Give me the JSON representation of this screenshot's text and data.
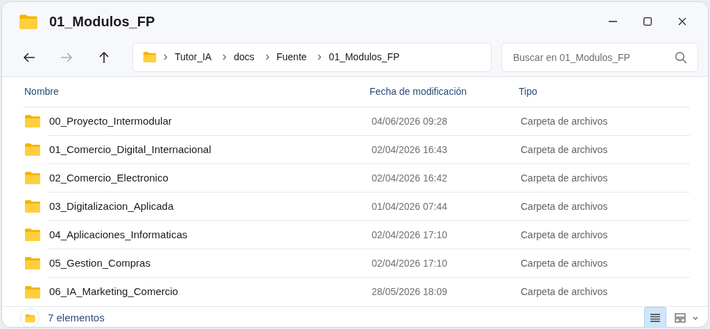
{
  "window": {
    "title": "01_Modulos_FP"
  },
  "breadcrumb": [
    "Tutor_IA",
    "docs",
    "Fuente",
    "01_Modulos_FP"
  ],
  "search": {
    "placeholder": "Buscar en 01_Modulos_FP"
  },
  "table": {
    "columns": [
      "Nombre",
      "Fecha de modificación",
      "Tipo"
    ],
    "rows": [
      {
        "name": "00_Proyecto_Intermodular",
        "date": "04/06/2026 09:28",
        "type": "Carpeta de archivos"
      },
      {
        "name": "01_Comercio_Digital_Internacional",
        "date": "02/04/2026 16:43",
        "type": "Carpeta de archivos"
      },
      {
        "name": "02_Comercio_Electronico",
        "date": "02/04/2026 16:42",
        "type": "Carpeta de archivos"
      },
      {
        "name": "03_Digitalizacion_Aplicada",
        "date": "01/04/2026 07:44",
        "type": "Carpeta de archivos"
      },
      {
        "name": "04_Aplicaciones_Informaticas",
        "date": "02/04/2026 17:10",
        "type": "Carpeta de archivos"
      },
      {
        "name": "05_Gestion_Compras",
        "date": "02/04/2026 17:10",
        "type": "Carpeta de archivos"
      },
      {
        "name": "06_IA_Marketing_Comercio",
        "date": "28/05/2026 18:09",
        "type": "Carpeta de archivos"
      }
    ]
  },
  "status_bar": {
    "count": "7 elementos",
    "views": [
      {
        "kind": "details",
        "selected": true
      },
      {
        "kind": "tiles",
        "selected": false
      }
    ]
  }
}
